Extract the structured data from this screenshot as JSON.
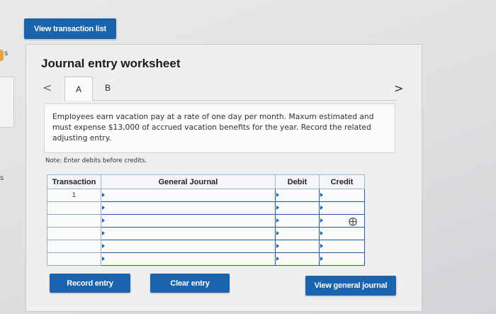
{
  "top_button": {
    "label": "View transaction list"
  },
  "worksheet": {
    "title": "Journal entry worksheet",
    "nav_prev_symbol": "<",
    "nav_next_symbol": ">",
    "tabs": [
      {
        "label": "A",
        "active": true
      },
      {
        "label": "B",
        "active": false
      }
    ],
    "description": "Employees earn vacation pay at a rate of one day per month. Maxum estimated and must expense $13,000 of accrued vacation benefits for the year. Record the related adjusting entry.",
    "note": "Note: Enter debits before credits."
  },
  "journal_table": {
    "headers": {
      "transaction": "Transaction",
      "general_journal": "General Journal",
      "debit": "Debit",
      "credit": "Credit"
    },
    "rows": [
      {
        "transaction": "1",
        "account": "",
        "debit": "",
        "credit": ""
      },
      {
        "transaction": "",
        "account": "",
        "debit": "",
        "credit": ""
      },
      {
        "transaction": "",
        "account": "",
        "debit": "",
        "credit": ""
      },
      {
        "transaction": "",
        "account": "",
        "debit": "",
        "credit": ""
      },
      {
        "transaction": "",
        "account": "",
        "debit": "",
        "credit": ""
      },
      {
        "transaction": "",
        "account": "",
        "debit": "",
        "credit": ""
      }
    ]
  },
  "buttons": {
    "record": "Record entry",
    "clear": "Clear entry",
    "view_general": "View general journal"
  },
  "edge_labels": {
    "upper": "s",
    "lower": "s"
  },
  "colors": {
    "button_blue": "#1a63ad",
    "input_border": "#1c5ea8"
  }
}
